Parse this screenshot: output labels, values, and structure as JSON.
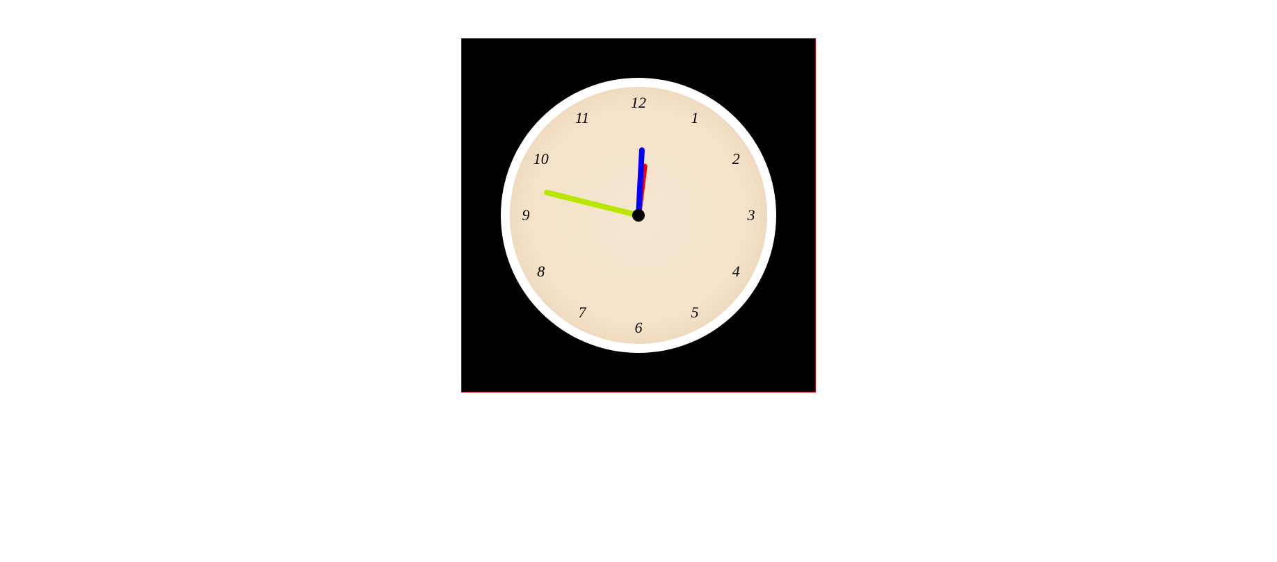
{
  "clock": {
    "numbers": [
      "12",
      "1",
      "2",
      "3",
      "4",
      "5",
      "6",
      "7",
      "8",
      "9",
      "10",
      "11"
    ],
    "hands": {
      "hour": {
        "color": "#ff0000",
        "width": 8,
        "length": 75,
        "angle": 187
      },
      "minute": {
        "color": "#0000ff",
        "width": 8,
        "length": 98,
        "angle": 183
      },
      "second": {
        "color": "#b8e600",
        "width": 8,
        "length": 140,
        "angle": 104
      }
    },
    "face_radius_px": 185,
    "number_radius_px": 162
  }
}
